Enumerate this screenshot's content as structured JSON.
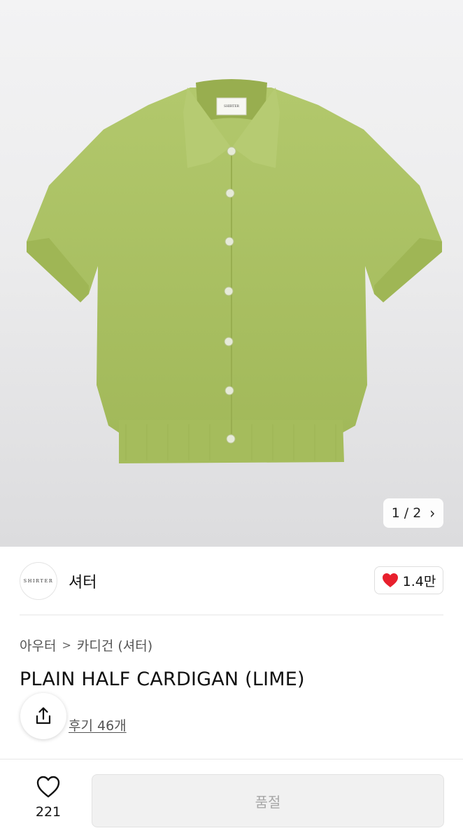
{
  "gallery": {
    "current": "1",
    "separator": "/",
    "total": "2",
    "next_icon": "chevron-right-icon",
    "garment_color": "#a9c062",
    "label_text": "SHIRTER"
  },
  "brand": {
    "logo_text": "SHIRTER",
    "name": "셔터",
    "likes": "1.4만",
    "like_icon": "heart-filled-icon",
    "like_color": "#e8202d"
  },
  "breadcrumb": {
    "level1": "아우터",
    "separator": ">",
    "level2": "카디건 (셔터)"
  },
  "product": {
    "title": "PLAIN HALF CARDIGAN (LIME)",
    "reviews": "후기 46개"
  },
  "share": {
    "icon": "share-icon"
  },
  "bottom_bar": {
    "wish_icon": "heart-outline-icon",
    "wish_count": "221",
    "buy_label": "품절"
  }
}
